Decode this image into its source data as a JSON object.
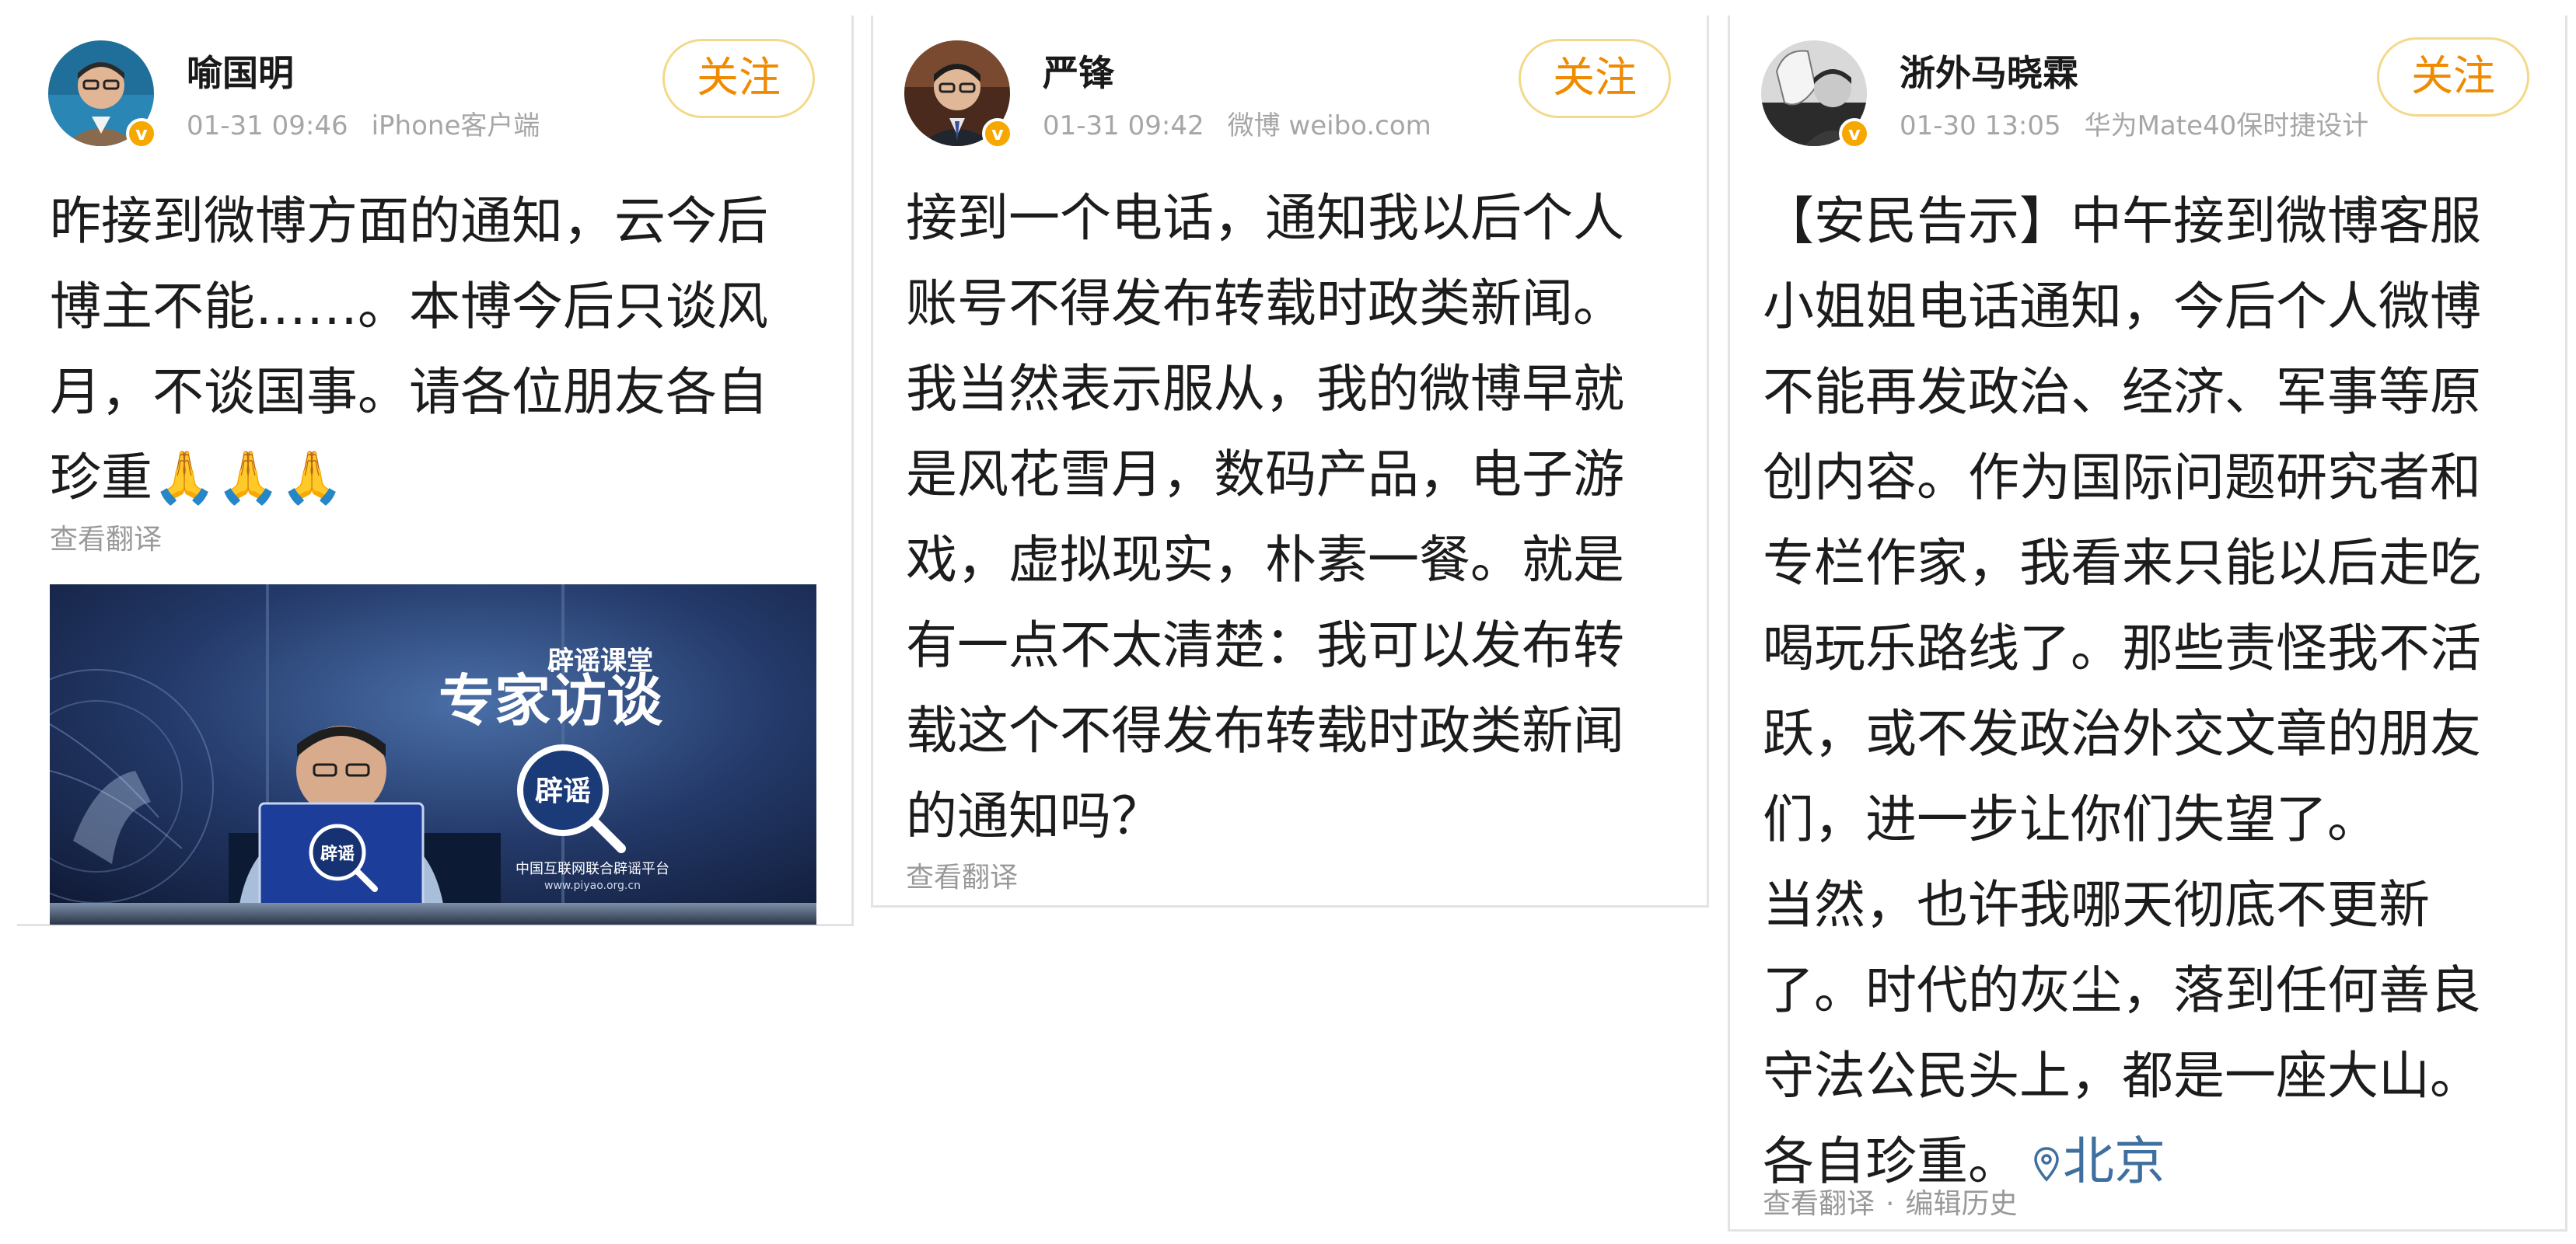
{
  "posts": [
    {
      "username": "喻国明",
      "time": "01-31 09:46",
      "source": "iPhone客户端",
      "follow_label": "关注",
      "text": "昨接到微博方面的通知，云今后\n博主不能……。本博今后只谈风\n月，不谈国事。请各位朋友各自\n珍重🙏🙏🙏",
      "translate_label": "查看翻译",
      "image": {
        "title_small": "辟谣课堂",
        "title_big": "专家访谈",
        "logo_text": "辟谣",
        "platform": "中国互联网联合辟谣平台",
        "url": "www.piyao.org.cn"
      }
    },
    {
      "username": "严锋",
      "time": "01-31 09:42",
      "source": "微博 weibo.com",
      "follow_label": "关注",
      "text": "接到一个电话，通知我以后个人\n账号不得发布转载时政类新闻。\n我当然表示服从，我的微博早就\n是风花雪月，数码产品，电子游\n戏，虚拟现实，朴素一餐。就是\n有一点不太清楚：我可以发布转\n载这个不得发布转载时政类新闻\n的通知吗？",
      "translate_label": "查看翻译"
    },
    {
      "username": "浙外马晓霖",
      "time": "01-30 13:05",
      "source": "华为Mate40保时捷设计",
      "follow_label": "关注",
      "text": "【安民告示】中午接到微博客服\n小姐姐电话通知，今后个人微博\n不能再发政治、经济、军事等原\n创内容。作为国际问题研究者和\n专栏作家，我看来只能以后走吃\n喝玩乐路线了。那些责怪我不活\n跃，或不发政治外交文章的朋友\n们，进一步让你们失望了。\n当然，也许我哪天彻底不更新\n了。时代的灰尘，落到任何善良\n守法公民头上，都是一座大山。\n各自珍重。",
      "location": "北京",
      "translate_label": "查看翻译",
      "edit_history_label": "编辑历史"
    }
  ],
  "colors": {
    "follow_text": "#f08a00",
    "follow_border": "#f3d98a",
    "verified_badge": "#f6a700",
    "meta_text": "#a6a6a6",
    "location_text": "#3f6f9e"
  }
}
